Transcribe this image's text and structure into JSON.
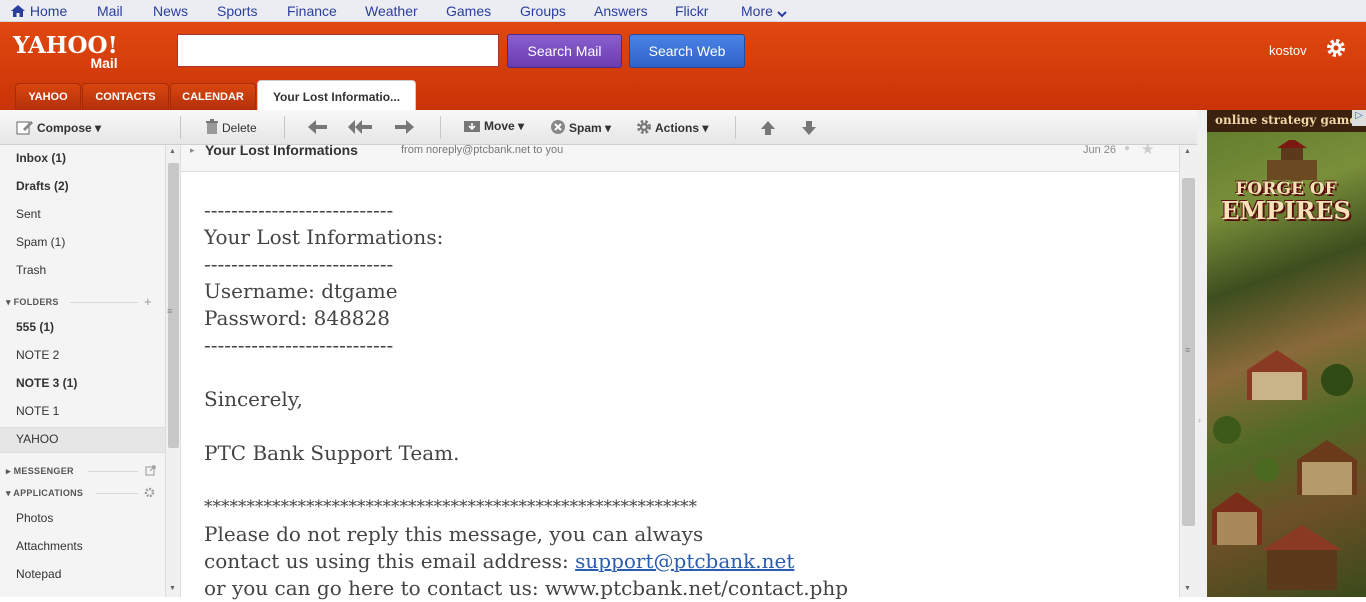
{
  "topnav": {
    "items": [
      "Home",
      "Mail",
      "News",
      "Sports",
      "Finance",
      "Weather",
      "Games",
      "Groups",
      "Answers",
      "Flickr",
      "More"
    ]
  },
  "header": {
    "logo_line1": "YAHOO!",
    "logo_line2": "Mail",
    "search_value": "",
    "search_mail_label": "Search Mail",
    "search_web_label": "Search Web",
    "username": "kostov"
  },
  "tabs": [
    "YAHOO",
    "CONTACTS",
    "CALENDAR",
    "Your Lost Informatio..."
  ],
  "toolbar": {
    "compose": "Compose",
    "delete": "Delete",
    "move": "Move",
    "spam": "Spam",
    "actions": "Actions"
  },
  "sidebar": {
    "folders_main": [
      "Inbox (1)",
      "Drafts (2)",
      "Sent",
      "Spam (1)",
      "Trash"
    ],
    "folders_header": "FOLDERS",
    "folders": [
      "555 (1)",
      "NOTE 2",
      "NOTE 3 (1)",
      "NOTE 1",
      "YAHOO"
    ],
    "messenger_header": "MESSENGER",
    "applications_header": "APPLICATIONS",
    "apps": [
      "Photos",
      "Attachments",
      "Notepad"
    ]
  },
  "message": {
    "subject": "Your Lost Informations",
    "from": "from noreply@ptcbank.net to you",
    "date": "Jun 26",
    "body": {
      "sep": "----------------------------",
      "title": "Your Lost Informations:",
      "username": "Username: dtgame",
      "password": "Password: 848828",
      "sincerely": "Sincerely,",
      "team": "PTC Bank Support Team.",
      "stars": "**********************************************************",
      "note1": "Please do not reply this message, you can always",
      "note2": "contact us using this email address: ",
      "email": "support@ptcbank.net",
      "note3": "or you can go here to contact us: www.ptcbank.net/contact.php"
    }
  },
  "ad": {
    "title": "online strategy game",
    "logo_line1": "FORGE OF",
    "logo_line2": "EMPIRES"
  },
  "colors": {
    "header": "#d23f0c",
    "search_mail": "#6a3cb1",
    "search_web": "#2f63c9",
    "nav_link": "#2a3e9e"
  }
}
